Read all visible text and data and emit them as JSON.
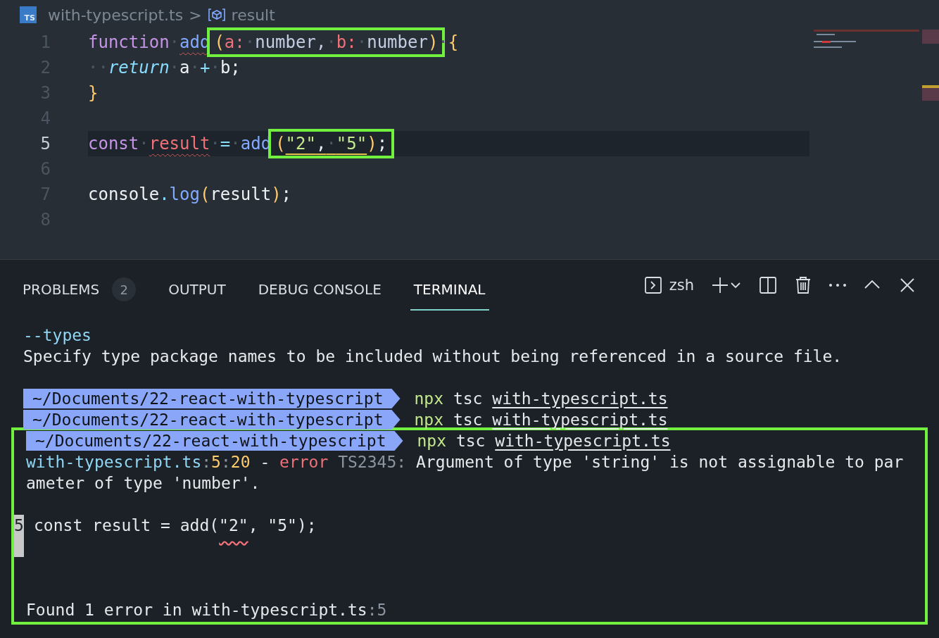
{
  "breadcrumb": {
    "file_badge": "TS",
    "file": "with-typescript.ts",
    "separator": ">",
    "symbol": "result"
  },
  "editor": {
    "lines": [
      {
        "number": "1",
        "current": false,
        "parts": [
          {
            "text": "function",
            "kind": "keyword"
          },
          {
            "text": "·",
            "kind": "ws"
          },
          {
            "text": "add",
            "kind": "function",
            "error_squiggle": true
          },
          {
            "kind": "box",
            "tokens": [
              {
                "text": "(",
                "kind": "bracket"
              },
              {
                "text": "a:",
                "kind": "param"
              },
              {
                "text": "·",
                "kind": "ws"
              },
              {
                "text": "number,",
                "kind": "type"
              },
              {
                "text": "·",
                "kind": "ws"
              },
              {
                "text": "b:",
                "kind": "param"
              },
              {
                "text": "·",
                "kind": "ws"
              },
              {
                "text": "number",
                "kind": "type"
              },
              {
                "text": ")",
                "kind": "bracket"
              }
            ]
          },
          {
            "text": "·",
            "kind": "ws"
          },
          {
            "text": "{",
            "kind": "bracket"
          }
        ]
      },
      {
        "number": "2",
        "current": false,
        "parts": [
          {
            "text": "··",
            "kind": "ws"
          },
          {
            "text": "return",
            "kind": "control"
          },
          {
            "text": "·",
            "kind": "ws"
          },
          {
            "text": "a",
            "kind": "plain"
          },
          {
            "text": "·",
            "kind": "ws"
          },
          {
            "text": "+",
            "kind": "operator"
          },
          {
            "text": "·",
            "kind": "ws"
          },
          {
            "text": "b;",
            "kind": "plain"
          }
        ]
      },
      {
        "number": "3",
        "current": false,
        "parts": [
          {
            "text": "}",
            "kind": "bracket"
          }
        ]
      },
      {
        "number": "4",
        "current": false
      },
      {
        "number": "5",
        "current": true,
        "parts": [
          {
            "text": "const",
            "kind": "keyword"
          },
          {
            "text": "·",
            "kind": "ws"
          },
          {
            "text": "result",
            "kind": "variable",
            "error_squiggle": true
          },
          {
            "text": "·",
            "kind": "ws"
          },
          {
            "text": "=",
            "kind": "operator"
          },
          {
            "text": "·",
            "kind": "ws"
          },
          {
            "text": "add",
            "kind": "function"
          },
          {
            "kind": "box",
            "tokens": [
              {
                "text": "(",
                "kind": "bracket"
              },
              {
                "text": "\"2\"",
                "kind": "string",
                "warning_underline": true
              },
              {
                "text": ",",
                "kind": "plain",
                "warning_underline": true
              },
              {
                "text": "·",
                "kind": "ws",
                "warning_underline": true
              },
              {
                "text": "\"5\"",
                "kind": "string",
                "warning_underline": true
              },
              {
                "text": ")",
                "kind": "bracket"
              },
              {
                "text": ";",
                "kind": "plain"
              }
            ]
          }
        ]
      },
      {
        "number": "6",
        "current": false
      },
      {
        "number": "7",
        "current": false,
        "parts": [
          {
            "text": "console",
            "kind": "plain"
          },
          {
            "text": ".",
            "kind": "operator"
          },
          {
            "text": "log",
            "kind": "function"
          },
          {
            "text": "(",
            "kind": "bracket"
          },
          {
            "text": "result",
            "kind": "plain"
          },
          {
            "text": ")",
            "kind": "bracket"
          },
          {
            "text": ";",
            "kind": "plain"
          }
        ]
      },
      {
        "number": "8",
        "current": false
      }
    ]
  },
  "panel": {
    "tabs": [
      {
        "label": "PROBLEMS",
        "badge": "2",
        "selected": false
      },
      {
        "label": "OUTPUT",
        "selected": false
      },
      {
        "label": "DEBUG CONSOLE",
        "selected": false
      },
      {
        "label": "TERMINAL",
        "selected": true
      }
    ],
    "shell": "zsh"
  },
  "terminal": {
    "lines": [
      {
        "kind": "text",
        "tokens": [
          {
            "text": "--types",
            "kind": "file"
          }
        ]
      },
      {
        "kind": "text",
        "tokens": [
          {
            "text": "Specify type package names to be included without being referenced in a source file.",
            "kind": "plain"
          }
        ]
      },
      {
        "kind": "blank"
      },
      {
        "kind": "prompt",
        "path": "~/Documents/22-react-with-typescript",
        "tokens": [
          {
            "text": "npx",
            "kind": "command"
          },
          {
            "text": " tsc ",
            "kind": "plain"
          },
          {
            "text": "with-typescript.ts",
            "kind": "link"
          }
        ]
      },
      {
        "kind": "prompt",
        "path": "~/Documents/22-react-with-typescript",
        "tokens": [
          {
            "text": "npx",
            "kind": "command"
          },
          {
            "text": " tsc ",
            "kind": "plain"
          },
          {
            "text": "with-typescript.ts",
            "kind": "link"
          }
        ]
      }
    ],
    "highlighted_lines": [
      {
        "kind": "prompt",
        "path": "~/Documents/22-react-with-typescript",
        "tokens": [
          {
            "text": "npx",
            "kind": "command"
          },
          {
            "text": " tsc ",
            "kind": "plain"
          },
          {
            "text": "with-typescript.ts",
            "kind": "link"
          }
        ]
      },
      {
        "kind": "text",
        "tokens": [
          {
            "text": "with-typescript.ts",
            "kind": "file"
          },
          {
            "text": ":",
            "kind": "dim"
          },
          {
            "text": "5",
            "kind": "number"
          },
          {
            "text": ":",
            "kind": "dim"
          },
          {
            "text": "20",
            "kind": "number"
          },
          {
            "text": " - ",
            "kind": "plain"
          },
          {
            "text": "error",
            "kind": "error"
          },
          {
            "text": " TS2345:",
            "kind": "dim"
          },
          {
            "text": " Argument of type 'string' is not assignable to par",
            "kind": "plain"
          }
        ]
      },
      {
        "kind": "text",
        "tokens": [
          {
            "text": "ameter of type 'number'.",
            "kind": "plain"
          }
        ]
      },
      {
        "kind": "blank"
      },
      {
        "kind": "source",
        "gutter": "5",
        "tokens": [
          {
            "text": "const result = add(",
            "kind": "plain"
          },
          {
            "text": "\"2\"",
            "kind": "plain",
            "error_squiggle": true
          },
          {
            "text": ", \"5\");",
            "kind": "plain"
          }
        ]
      },
      {
        "kind": "blank"
      },
      {
        "kind": "blank"
      },
      {
        "kind": "text",
        "tokens": [
          {
            "text": "Found 1 error in with-typescript.ts",
            "kind": "plain"
          },
          {
            "text": ":",
            "kind": "dim"
          },
          {
            "text": "5",
            "kind": "dim"
          }
        ]
      }
    ]
  }
}
